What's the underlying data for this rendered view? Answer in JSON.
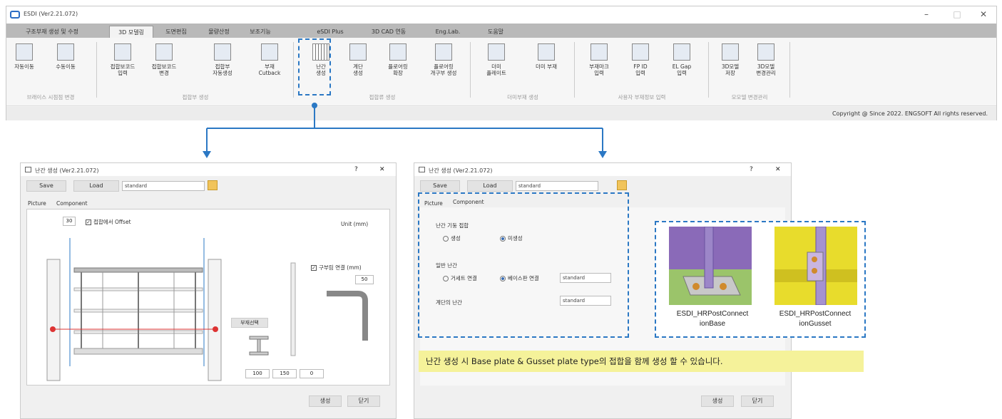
{
  "app": {
    "title": "ESDI (Ver2.21.072)",
    "minimize": "–",
    "maximize": "□",
    "close": "✕",
    "copyright": "Copyright @ Since 2022. ENGSOFT All rights reserved."
  },
  "ribbon_tabs": [
    "구조부재 생성 및 수정",
    "3D 모델링",
    "도면편집",
    "물량산정",
    "보조기능",
    "eSDI Plus",
    "3D CAD 연동",
    "Eng.Lab.",
    "도움말"
  ],
  "toolbar": {
    "buttons": [
      {
        "label": "자동이동",
        "icon": "auto-move-icon"
      },
      {
        "label": "수동이동",
        "icon": "manual-move-icon"
      },
      {
        "label": "접합보코드\n입력",
        "icon": "joint-code-input-icon"
      },
      {
        "label": "접합보코드\n변경",
        "icon": "joint-code-change-icon"
      },
      {
        "label": "접합부\n자동생성",
        "icon": "joint-auto-create-icon"
      },
      {
        "label": "부재\nCutback",
        "icon": "member-cutback-icon"
      },
      {
        "label": "난간\n생성",
        "icon": "railing-create-icon"
      },
      {
        "label": "계단\n생성",
        "icon": "stair-create-icon"
      },
      {
        "label": "플로어링\n확장",
        "icon": "flooring-extend-icon"
      },
      {
        "label": "플로어링\n개구부 생성",
        "icon": "flooring-opening-icon"
      },
      {
        "label": "더미\n플레이트",
        "icon": "dummy-plate-icon"
      },
      {
        "label": "더미 부재",
        "icon": "dummy-member-icon"
      },
      {
        "label": "부재마크\n입력",
        "icon": "member-mark-icon"
      },
      {
        "label": "FP ID\n입력",
        "icon": "fp-id-icon"
      },
      {
        "label": "EL Gap\n입력",
        "icon": "el-gap-icon"
      },
      {
        "label": "3D모델\n저장",
        "icon": "model-save-icon"
      },
      {
        "label": "3D모델\n변경관리",
        "icon": "model-change-icon"
      }
    ],
    "groups": [
      "브래이스 시점점 변경",
      "접합부 생성",
      "접합류 생성",
      "더미부재 생성",
      "사용자 부재정보 입력",
      "모모델 변경관리"
    ]
  },
  "dialog_left": {
    "title": "난간 생성 (Ver2.21.072)",
    "help": "?",
    "close": "✕",
    "save": "Save",
    "load": "Load",
    "combo": "standard",
    "tabs": [
      "Picture",
      "Component"
    ],
    "offset_value": "30",
    "offset_label": "접합에서 Offset",
    "unit": "Unit (mm)",
    "member_select": "부재선택",
    "extend_label": "구부림 연결 (mm)",
    "extend_value": "50",
    "dims": [
      "100",
      "150",
      "0"
    ],
    "ok": "생성",
    "cancel": "닫기"
  },
  "dialog_right": {
    "title": "난간 생성 (Ver2.21.072)",
    "help": "?",
    "close": "✕",
    "save": "Save",
    "load": "Load",
    "combo": "standard",
    "tabs": [
      "Picture",
      "Component"
    ],
    "joint_label": "난간 기둥 접합",
    "joint_opt1": "생성",
    "joint_opt2": "미생성",
    "normal_label": "일반 난간",
    "normal_opt1": "거세트 연결",
    "normal_opt2": "베이스판 연결",
    "normal_combo": "standard",
    "stair_label": "계단의 난간",
    "stair_combo": "standard",
    "ok": "생성",
    "cancel": "닫기"
  },
  "preview": {
    "base_caption": "ESDI_HRPostConnect\nionBase",
    "gusset_caption": "ESDI_HRPostConnect\nionGusset"
  },
  "note": "난간 생성 시 Base plate & Gusset plate type의 접합을 함께 생성 할 수 있습니다.",
  "colors": {
    "accent": "#2b78c4",
    "note_bg": "#f5f29a",
    "purple": "#8a6ab8",
    "yellow": "#e8dc2c",
    "green": "#9bc46a"
  }
}
